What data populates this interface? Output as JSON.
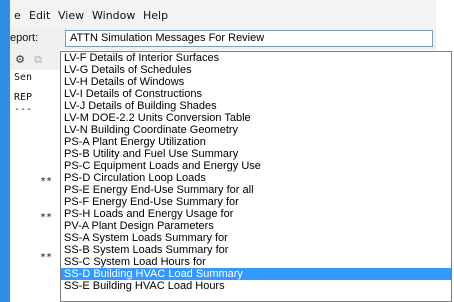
{
  "menu": {
    "items": [
      "e",
      "Edit",
      "View",
      "Window",
      "Help"
    ]
  },
  "report": {
    "label": "eport:",
    "selected_value": "ATTN Simulation Messages For Review"
  },
  "toolbar": {
    "buttons": [
      "⚙",
      "⧉"
    ]
  },
  "document": {
    "lines": [
      "Sen",
      "REP",
      "---",
      "**",
      "**",
      "**"
    ]
  },
  "dropdown": {
    "options": [
      "LV-F Details of Interior Surfaces",
      "LV-G Details of Schedules",
      "LV-H Details of Windows",
      "LV-I Details of Constructions",
      "LV-J Details of Building Shades",
      "LV-M DOE-2.2 Units Conversion Table",
      "LV-N Building Coordinate Geometry",
      "PS-A Plant Energy Utilization",
      "PS-B Utility and Fuel Use Summary",
      "PS-C Equipment Loads and Energy Use",
      "PS-D Circulation Loop Loads",
      "PS-E Energy End-Use Summary for all",
      "PS-F Energy End-Use Summary for",
      "PS-H Loads and Energy Usage for",
      "PV-A Plant Design Parameters",
      "SS-A System Loads Summary for",
      "SS-B System Loads Summary for",
      "SS-C System Load Hours for",
      "SS-D Building HVAC Load Summary",
      "SS-E Building HVAC Load Hours"
    ],
    "selected_index": 18
  },
  "colors": {
    "selection": "#3399ff",
    "desktop_strip": "#2f8fe0"
  }
}
